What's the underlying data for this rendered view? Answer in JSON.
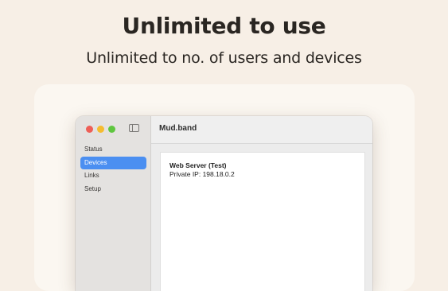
{
  "hero": {
    "headline": "Unlimited to use",
    "subheadline": "Unlimited to no. of users and devices"
  },
  "window": {
    "title": "Mud.band",
    "traffic_lights": {
      "close": "#ee5f57",
      "minimize": "#f5bc30",
      "zoom": "#5fc63f"
    },
    "toggle_icon": "sidebar-toggle-icon"
  },
  "sidebar": {
    "items": [
      {
        "label": "Status",
        "active": false
      },
      {
        "label": "Devices",
        "active": true
      },
      {
        "label": "Links",
        "active": false
      },
      {
        "label": "Setup",
        "active": false
      }
    ],
    "accent": "#4b8ff1"
  },
  "device": {
    "name": "Web Server (Test)",
    "ip_text": "Private IP: 198.18.0.2"
  }
}
